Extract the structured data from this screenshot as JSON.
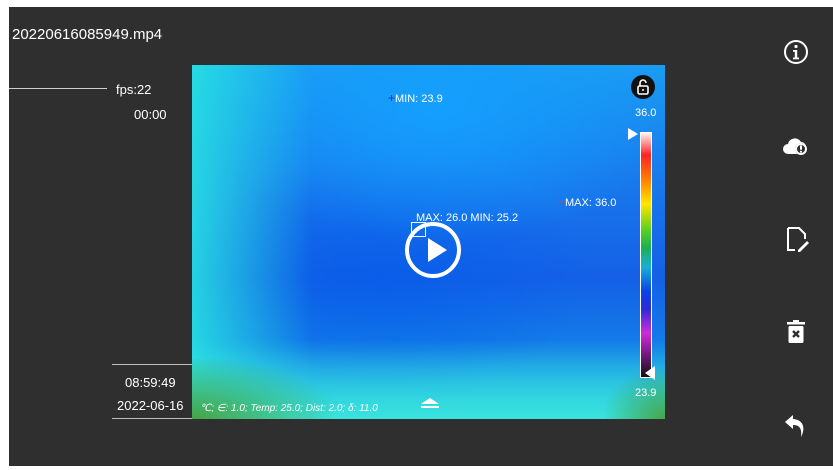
{
  "file": {
    "name": "20220616085949.mp4"
  },
  "playback": {
    "fps_label": "fps:22",
    "elapsed": "00:00"
  },
  "recording": {
    "time": "08:59:49",
    "date": "2022-06-16"
  },
  "thermal": {
    "min_point_label": "MIN: 23.9",
    "max_point_label": "MAX: 36.0",
    "center_label": "MAX: 26.0 MIN: 25.2",
    "scale_max": "36.0",
    "scale_min": "23.9",
    "params": "℃; ∈: 1.0; Temp: 25.0; Dist: 2.0; δ: 11.0"
  },
  "icons": {
    "play": "play-icon",
    "lock": "unlock-icon",
    "info": "info-icon",
    "cloud": "cloud-alert-icon",
    "edit": "edit-note-icon",
    "delete": "delete-icon",
    "back": "back-icon",
    "expand": "eject-icon"
  },
  "colors": {
    "background": "#2f2f2f",
    "min_marker": "#1d2bd0",
    "max_marker": "#e23a3a"
  }
}
